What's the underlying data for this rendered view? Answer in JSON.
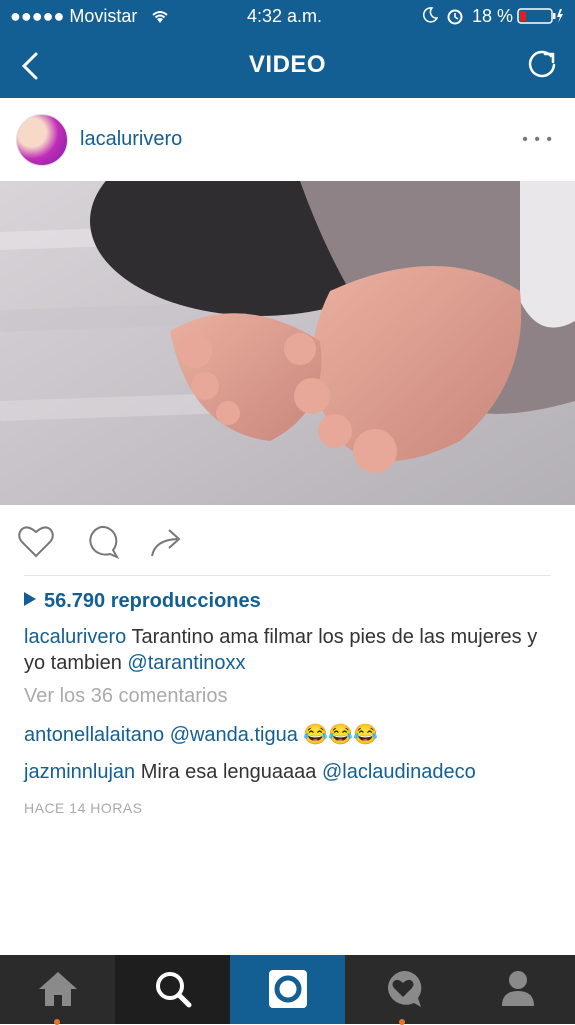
{
  "status_bar": {
    "carrier": "●●●●● Movistar",
    "time": "4:32 a.m.",
    "battery": "18 %"
  },
  "nav": {
    "title": "VIDEO",
    "back_icon": "chevron-left-icon",
    "refresh_icon": "refresh-icon"
  },
  "post": {
    "username": "lacalurivero",
    "more_icon": "more-dots",
    "views": "56.790 reproducciones",
    "caption_user": "lacalurivero",
    "caption_text": "Tarantino ama filmar los pies de las mujeres y yo tambien",
    "caption_mention": "@tarantinoxx",
    "view_comments": "Ver los 36 comentarios",
    "comments": [
      {
        "user": "antonellalaitano",
        "mention": "@wanda.tigua",
        "text": "",
        "emoji": "😂😂😂"
      },
      {
        "user": "jazminnlujan",
        "text": "Mira esa lenguaaaa",
        "mention": "@laclaudinadeco",
        "emoji": ""
      }
    ],
    "timestamp": "HACE 14 HORAS"
  },
  "actions": {
    "like_icon": "heart-icon",
    "comment_icon": "comment-bubble-icon",
    "share_icon": "share-arrow-icon"
  },
  "tabbar": {
    "active_tab": "camera",
    "tabs": [
      "home-icon",
      "search-icon",
      "camera-icon",
      "activity-heart-icon",
      "profile-icon"
    ],
    "accent": "#e8742c",
    "bar_color": "#135f94"
  }
}
